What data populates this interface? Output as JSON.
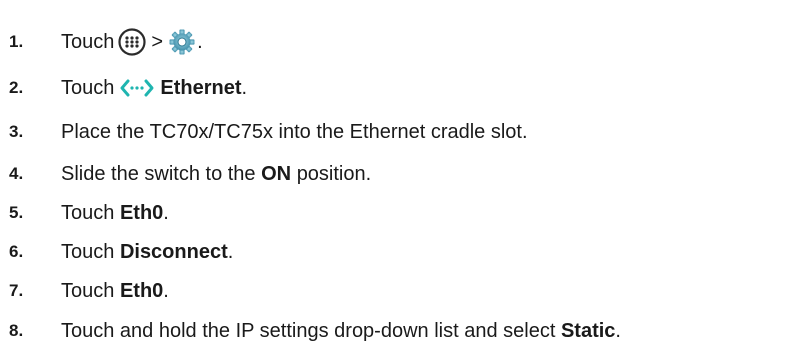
{
  "steps": [
    {
      "num": "1.",
      "pre": "Touch",
      "mid": ">",
      "post": "."
    },
    {
      "num": "2.",
      "pre": "Touch",
      "bold": "Ethernet",
      "post": "."
    },
    {
      "num": "3.",
      "pre": "Place the TC70x/TC75x into the Ethernet cradle slot."
    },
    {
      "num": "4.",
      "pre": "Slide the switch to the",
      "bold": "ON",
      "post": "position."
    },
    {
      "num": "5.",
      "pre": "Touch",
      "bold": "Eth0",
      "post": "."
    },
    {
      "num": "6.",
      "pre": "Touch",
      "bold": "Disconnect",
      "post": "."
    },
    {
      "num": "7.",
      "pre": "Touch",
      "bold": "Eth0",
      "post": "."
    },
    {
      "num": "8.",
      "pre": "Touch and hold the IP settings drop-down list and select",
      "bold": "Static",
      "post": "."
    }
  ],
  "icons": {
    "apps": "all-apps-icon",
    "settings": "settings-gear-icon",
    "ethernet": "ethernet-icon"
  },
  "colors": {
    "text": "#1a1a1a",
    "icon_dark": "#2b2b2b",
    "icon_teal": "#1fb5b0",
    "gear": "#4a9fb8"
  }
}
